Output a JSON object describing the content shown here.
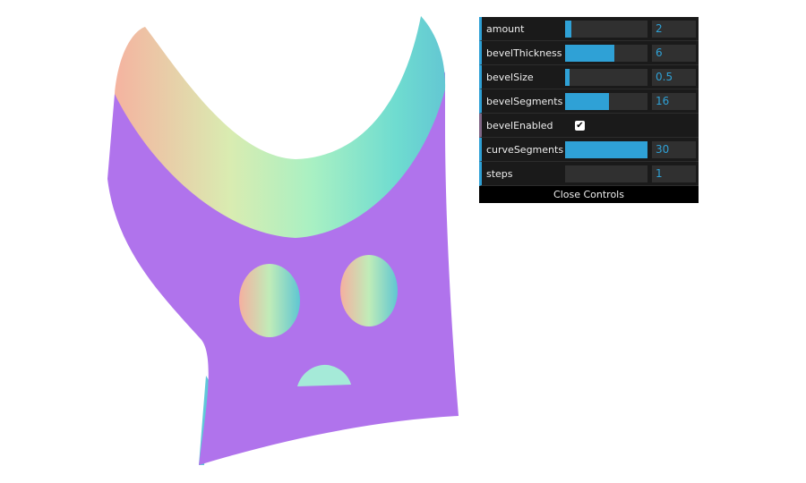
{
  "controls": [
    {
      "label": "amount",
      "type": "number",
      "value": "2",
      "fraction": 0.08
    },
    {
      "label": "bevelThickness",
      "type": "number",
      "value": "6",
      "fraction": 0.6
    },
    {
      "label": "bevelSize",
      "type": "number",
      "value": "0.5",
      "fraction": 0.05
    },
    {
      "label": "bevelSegments",
      "type": "number",
      "value": "16",
      "fraction": 0.53
    },
    {
      "label": "bevelEnabled",
      "type": "boolean",
      "checked": true,
      "check_glyph": "✔"
    },
    {
      "label": "curveSegments",
      "type": "number",
      "value": "30",
      "fraction": 1.0
    },
    {
      "label": "steps",
      "type": "number",
      "value": "1",
      "fraction": 0.0
    }
  ],
  "close_label": "Close Controls",
  "colors": {
    "body": "#b073ec",
    "teal": "#68d6d0",
    "peach": "#f5b3a0",
    "mint": "#a5f0c2",
    "panel_bg": "#1a1a1a",
    "accent": "#2fa1d6"
  }
}
